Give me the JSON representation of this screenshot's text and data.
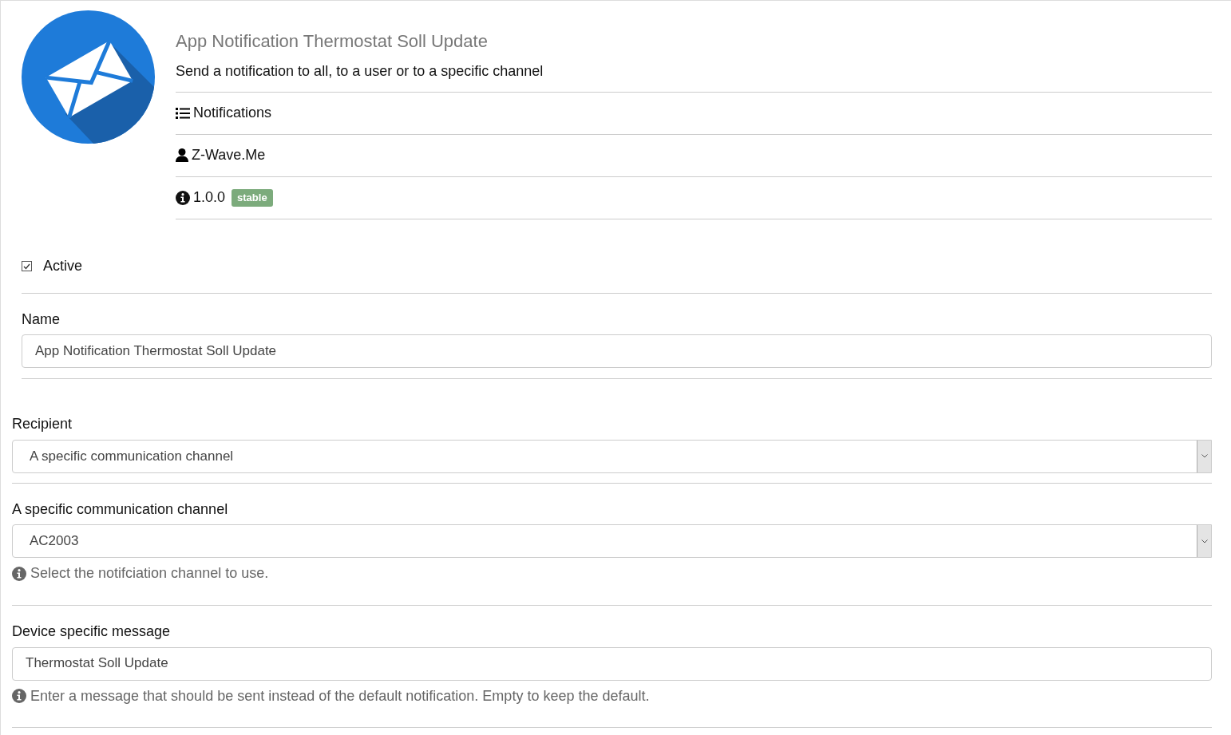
{
  "app": {
    "title": "App Notification Thermostat Soll Update",
    "description": "Send a notification to all, to a user or to a specific channel",
    "category": "Notifications",
    "author": "Z-Wave.Me",
    "version": "1.0.0",
    "maturity": "stable"
  },
  "active": {
    "label": "Active",
    "checked": true
  },
  "name_field": {
    "label": "Name",
    "value": "App Notification Thermostat Soll Update"
  },
  "fields": [
    {
      "kind": "select",
      "label": "Recipient",
      "value": "A specific communication channel"
    },
    {
      "kind": "select",
      "label": "A specific communication channel",
      "value": "AC2003",
      "help": "Select the notifciation channel to use."
    },
    {
      "kind": "input",
      "label": "Device specific message",
      "value": "Thermostat Soll Update",
      "help": "Enter a message that should be sent instead of the default notification. Empty to keep the default."
    }
  ]
}
